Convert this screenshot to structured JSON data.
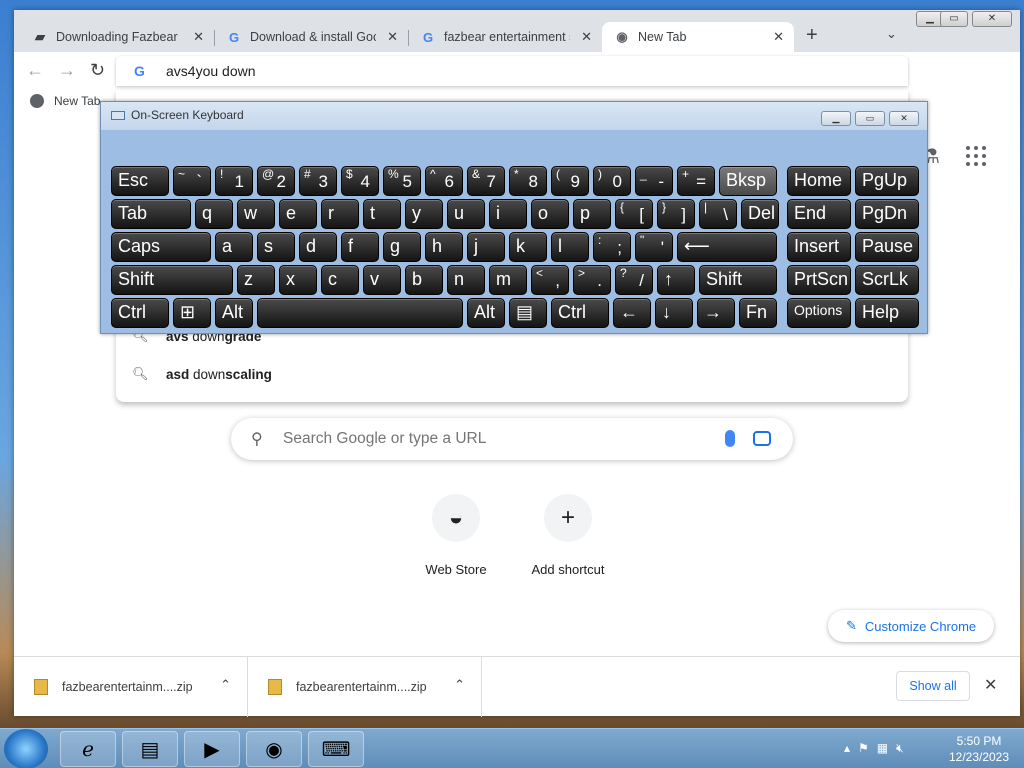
{
  "window": {
    "title": "New Tab"
  },
  "tabs": [
    {
      "title": "Downloading Fazbear En",
      "favicon": "fazbear-icon"
    },
    {
      "title": "Download & install Goo",
      "favicon": "google-icon"
    },
    {
      "title": "fazbear entertainment s",
      "favicon": "google-icon"
    },
    {
      "title": "New Tab",
      "favicon": "chrome-icon"
    }
  ],
  "omnibox": {
    "text": "avs4you down"
  },
  "bookmarks": [
    {
      "label": "New Tab"
    }
  ],
  "suggestions": [
    {
      "bold": "avs",
      "plain": " down",
      "bold2": "grade"
    },
    {
      "bold": "asd",
      "plain": " down",
      "bold2": "scaling"
    }
  ],
  "search": {
    "placeholder": "Search Google or type a URL"
  },
  "shortcuts": [
    {
      "label": "Web Store"
    },
    {
      "label": "Add shortcut"
    }
  ],
  "customize": {
    "label": "Customize Chrome"
  },
  "downloads": [
    {
      "name": "fazbearentertainm....zip"
    },
    {
      "name": "fazbearentertainm....zip"
    }
  ],
  "shelf": {
    "show_all": "Show all"
  },
  "osk": {
    "title": "On-Screen Keyboard",
    "rows": [
      [
        [
          "Esc"
        ],
        [
          "~",
          "`"
        ],
        [
          "!",
          "1"
        ],
        [
          "@",
          "2"
        ],
        [
          "#",
          "3"
        ],
        [
          "$",
          "4"
        ],
        [
          "%",
          "5"
        ],
        [
          "^",
          "6"
        ],
        [
          "&",
          "7"
        ],
        [
          "*",
          "8"
        ],
        [
          "(",
          "9"
        ],
        [
          ")",
          "0"
        ],
        [
          "_",
          "-"
        ],
        [
          "+",
          "="
        ],
        [
          "Bksp"
        ],
        [
          "Home"
        ],
        [
          "PgUp"
        ]
      ],
      [
        [
          "Tab"
        ],
        [
          "q"
        ],
        [
          "w"
        ],
        [
          "e"
        ],
        [
          "r"
        ],
        [
          "t"
        ],
        [
          "y"
        ],
        [
          "u"
        ],
        [
          "i"
        ],
        [
          "o"
        ],
        [
          "p"
        ],
        [
          "{",
          "["
        ],
        [
          "}",
          "]"
        ],
        [
          "|",
          "\\"
        ],
        [
          "Del"
        ],
        [
          "End"
        ],
        [
          "PgDn"
        ]
      ],
      [
        [
          "Caps"
        ],
        [
          "a"
        ],
        [
          "s"
        ],
        [
          "d"
        ],
        [
          "f"
        ],
        [
          "g"
        ],
        [
          "h"
        ],
        [
          "j"
        ],
        [
          "k"
        ],
        [
          "l"
        ],
        [
          ":",
          ";"
        ],
        [
          "\"",
          "'"
        ],
        [
          "⟵"
        ],
        [
          "Insert"
        ],
        [
          "Pause"
        ]
      ],
      [
        [
          "Shift"
        ],
        [
          "z"
        ],
        [
          "x"
        ],
        [
          "c"
        ],
        [
          "v"
        ],
        [
          "b"
        ],
        [
          "n"
        ],
        [
          "m"
        ],
        [
          "<",
          ","
        ],
        [
          ">",
          "."
        ],
        [
          "?",
          "/"
        ],
        [
          "↑"
        ],
        [
          "Shift"
        ],
        [
          "PrtScn"
        ],
        [
          "ScrLk"
        ]
      ],
      [
        [
          "Ctrl"
        ],
        [
          "⊞"
        ],
        [
          "Alt"
        ],
        [
          ""
        ],
        [
          "Alt"
        ],
        [
          "▤"
        ],
        [
          "Ctrl"
        ],
        [
          "←"
        ],
        [
          "↓"
        ],
        [
          "→"
        ],
        [
          "Fn"
        ],
        [
          "Options"
        ],
        [
          "Help"
        ]
      ]
    ]
  },
  "taskbar": {
    "time": "5:50 PM",
    "date": "12/23/2023"
  }
}
